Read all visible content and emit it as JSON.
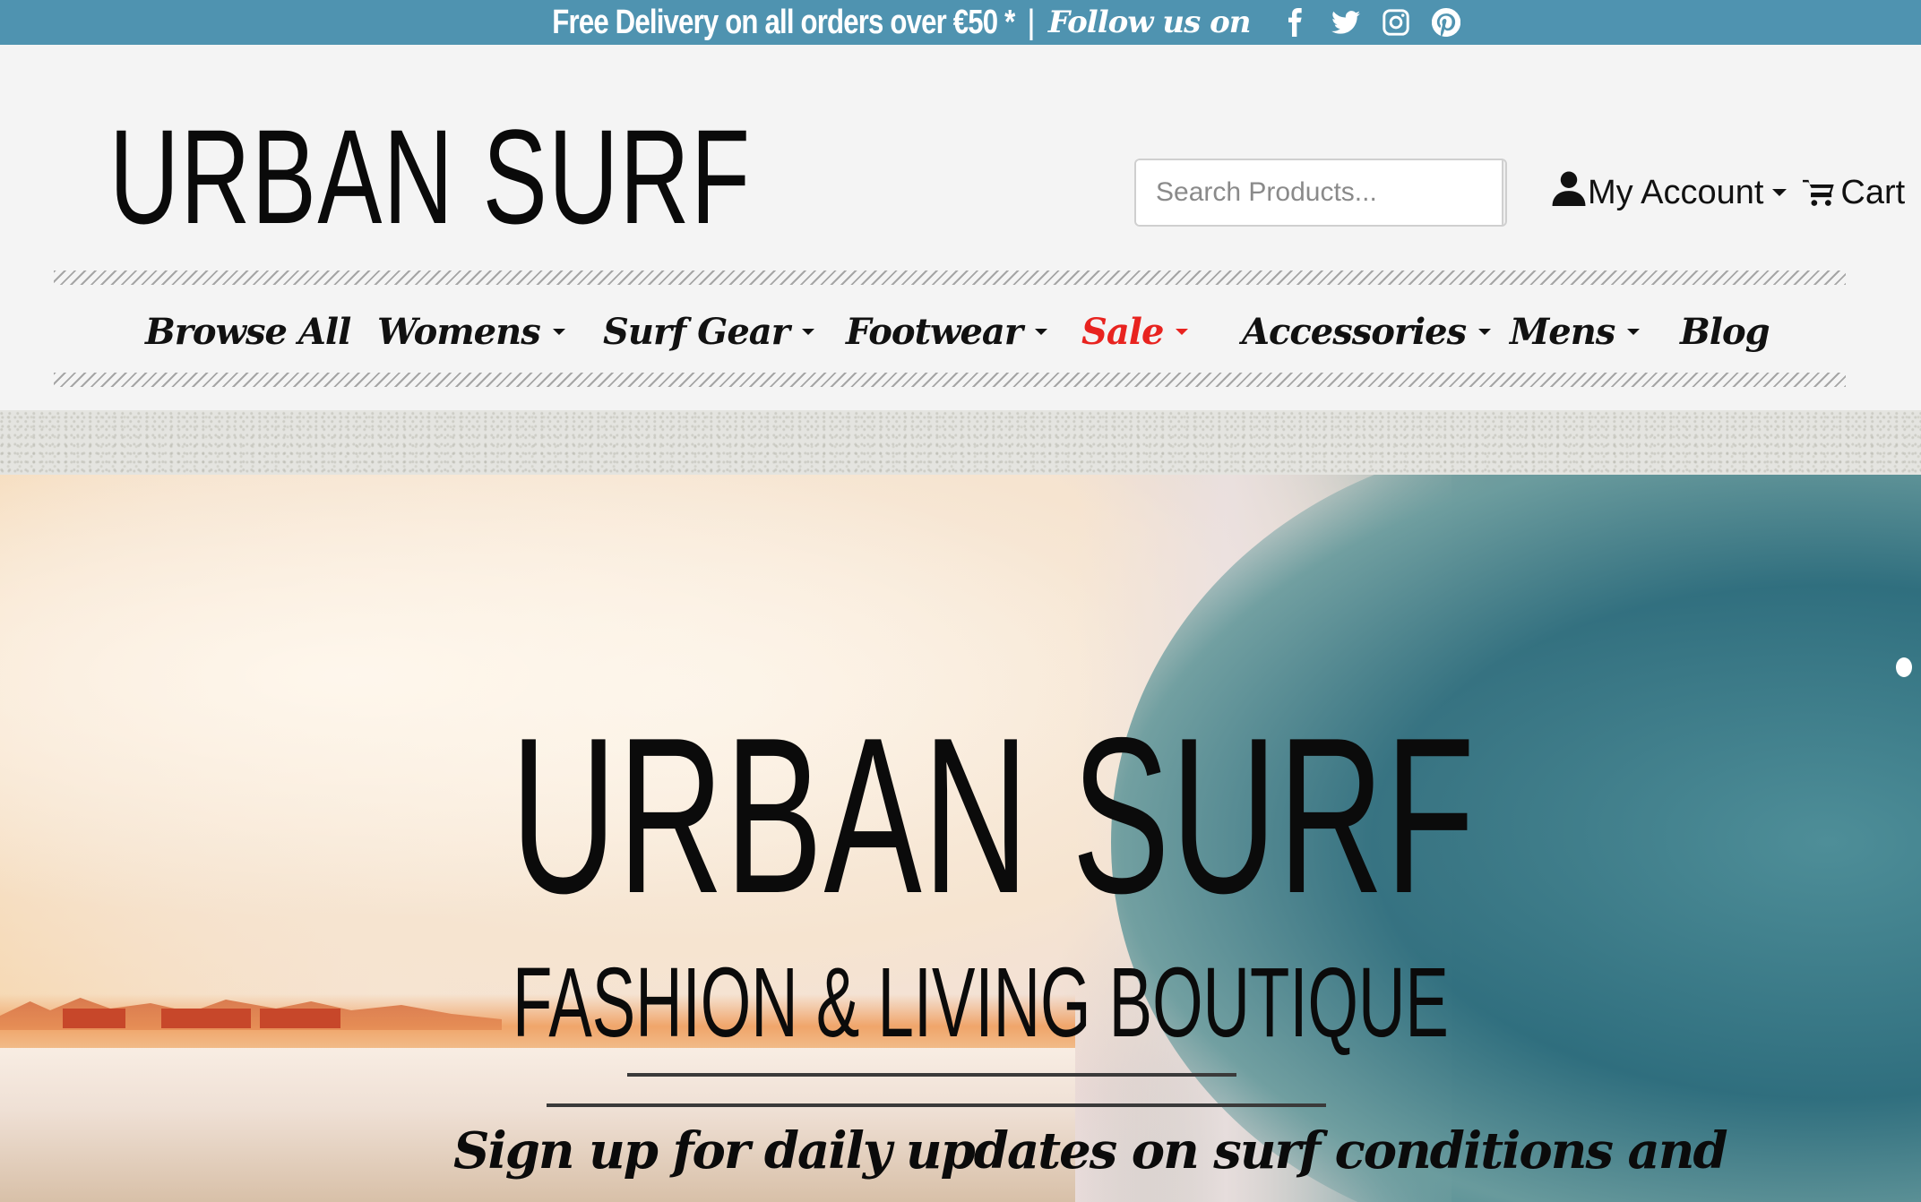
{
  "topbar": {
    "promo": "Free Delivery on all orders over €50 *",
    "separator": "|",
    "follow": "Follow us on",
    "social": [
      "facebook-icon",
      "twitter-icon",
      "instagram-icon",
      "pinterest-icon"
    ],
    "background": "#4f93b0"
  },
  "header": {
    "logo": "URBAN SURF",
    "search": {
      "placeholder": "Search Products..."
    },
    "account_label": "My Account",
    "cart_label": "Cart"
  },
  "nav": {
    "items": [
      {
        "label": "Browse All",
        "dropdown": false
      },
      {
        "label": "Womens",
        "dropdown": true
      },
      {
        "label": "Surf Gear",
        "dropdown": true
      },
      {
        "label": "Footwear",
        "dropdown": true
      },
      {
        "label": "Sale",
        "dropdown": true,
        "color": "#e8231f"
      },
      {
        "label": "Accessories",
        "dropdown": true
      },
      {
        "label": "Mens",
        "dropdown": true
      },
      {
        "label": "Blog",
        "dropdown": false
      }
    ]
  },
  "hero": {
    "title": "URBAN SURF",
    "subtitle": "FASHION & LIVING BOUTIQUE",
    "signup": "Sign up for daily updates on surf conditions and"
  }
}
